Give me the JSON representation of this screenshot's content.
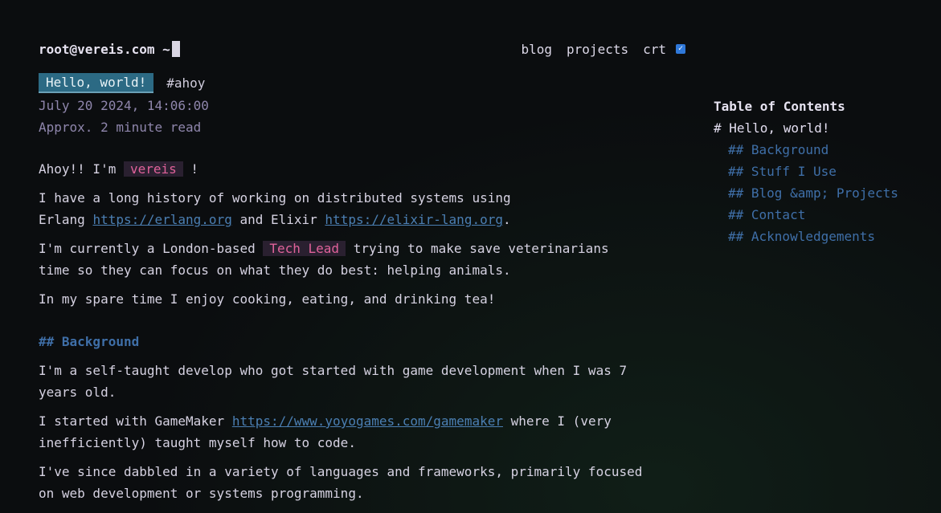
{
  "header": {
    "prompt": "root@vereis.com ~",
    "nav": {
      "blog": "blog",
      "projects": "projects",
      "crt": "crt"
    },
    "crt_checked": true
  },
  "post": {
    "title": "Hello, world!",
    "tag": "#ahoy",
    "date": "July 20 2024, 14:06:00",
    "read_time": "Approx. 2 minute read",
    "p1": {
      "a": "Ahoy!! I'm ",
      "name": "vereis",
      "b": " !"
    },
    "p2": {
      "a": "I have a long history of working on distributed systems using",
      "b": "Erlang ",
      "link1": "https://erlang.org",
      "c": " and Elixir ",
      "link2": "https://elixir-lang.org",
      "d": "."
    },
    "p3": {
      "a": "I'm currently a London-based ",
      "role": "Tech Lead",
      "b": " trying to make save veterinarians",
      "c": "time so they can focus on what they do best: helping animals."
    },
    "p4": "In my spare time I enjoy cooking, eating, and drinking tea!",
    "h_background": "## Background",
    "p5": {
      "a": "I'm a self-taught develop who got started with game development when I was 7",
      "b": "years old."
    },
    "p6": {
      "a": "I started with GameMaker ",
      "link": "https://www.yoyogames.com/gamemaker",
      "b": " where I (very",
      "c": "inefficiently) taught myself how to code."
    },
    "p7": {
      "a": "I've since dabbled in a variety of languages and frameworks, primarily focused",
      "b": "on web development or systems programming."
    }
  },
  "toc": {
    "title": "Table of Contents",
    "h1": "# Hello, world!",
    "items": [
      "## Background",
      "## Stuff I Use",
      "## Blog &amp; Projects",
      "## Contact",
      "## Acknowledgements"
    ]
  },
  "colors": {
    "background": "#0b0d0f",
    "text": "#d6d2e2",
    "meta": "#8f86ac",
    "link": "#4b7fb3",
    "heading": "#3f6fa8",
    "highlight_text": "#e0629a",
    "title_badge_bg": "#2c6a84"
  }
}
